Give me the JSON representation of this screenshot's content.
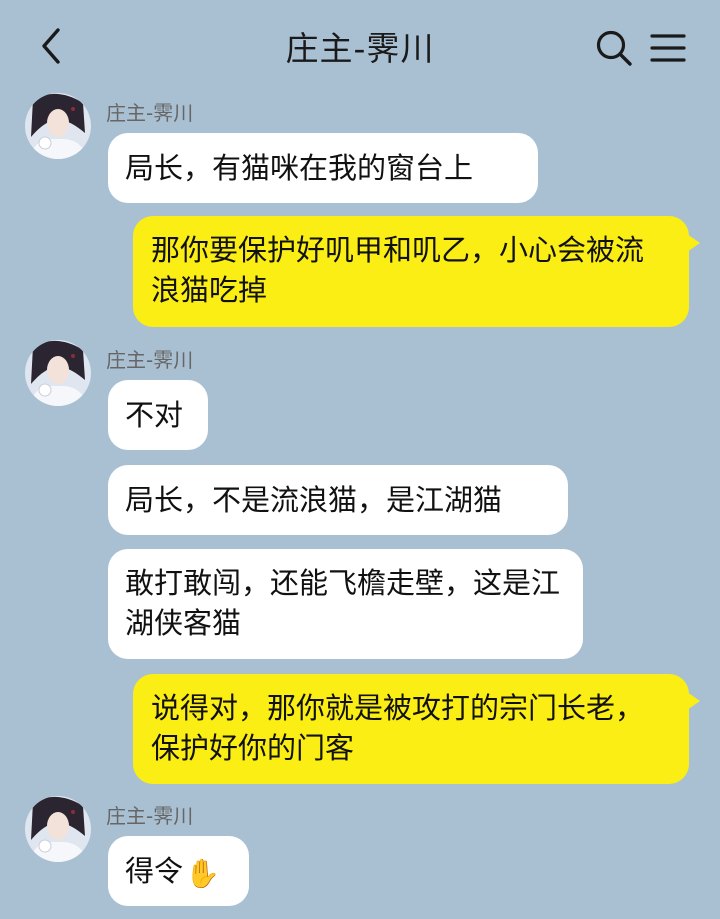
{
  "header": {
    "back_icon": "chevron-left-icon",
    "title": "庄主-霁川",
    "search_icon": "search-icon",
    "menu_icon": "menu-icon"
  },
  "messages": [
    {
      "sender": "庄主-霁川",
      "text": "局长，有猫咪在我的窗台上"
    },
    {
      "text": "那你要保护好叽甲和叽乙，小心会被流浪猫吃掉"
    },
    {
      "sender": "庄主-霁川",
      "text": "不对"
    },
    {
      "text": "局长，不是流浪猫，是江湖猫"
    },
    {
      "text": "敢打敢闯，还能飞檐走壁，这是江湖侠客猫"
    },
    {
      "text": "说得对，那你就是被攻打的宗门长老，保护好你的门客"
    },
    {
      "sender": "庄主-霁川",
      "text": "得令"
    }
  ],
  "colors": {
    "background": "#a9c0d3",
    "incoming_bubble": "#ffffff",
    "outgoing_bubble": "#fbee14"
  },
  "emoji": {
    "raised_hand": "✋"
  }
}
